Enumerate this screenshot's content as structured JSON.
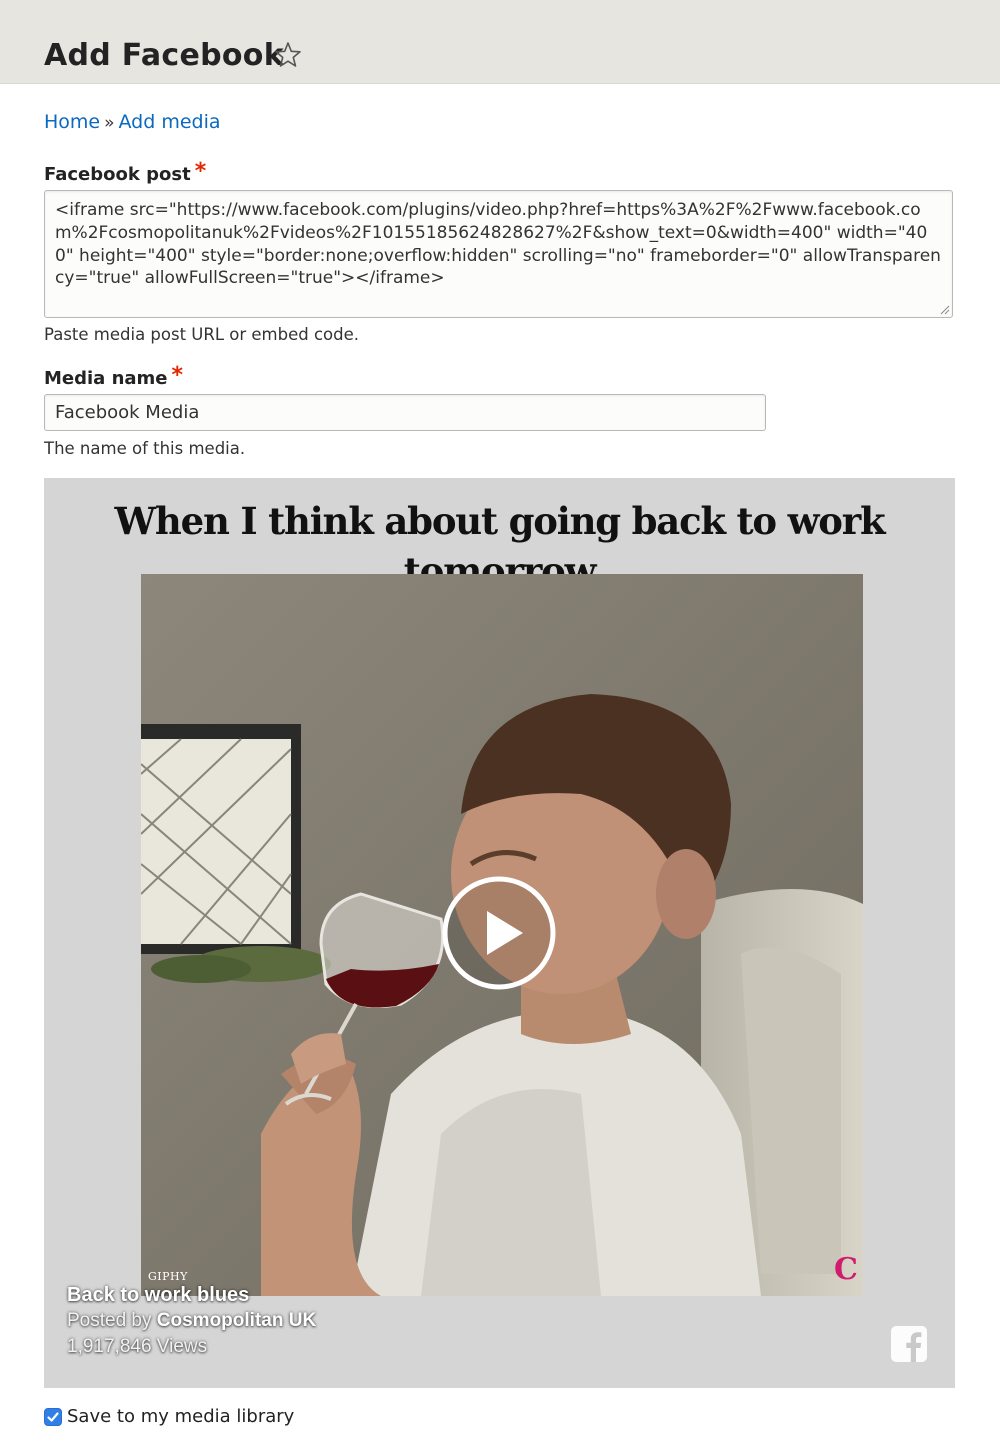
{
  "header": {
    "title": "Add Facebook",
    "favorite_icon": "star-outline-icon"
  },
  "breadcrumb": {
    "items": [
      "Home",
      "Add media"
    ],
    "separator": "»"
  },
  "facebook_post": {
    "label": "Facebook post",
    "required_marker": "*",
    "value": "<iframe src=\"https://www.facebook.com/plugins/video.php?href=https%3A%2F%2Fwww.facebook.com%2Fcosmopolitanuk%2Fvideos%2F10155185624828627%2F&show_text=0&width=400\" width=\"400\" height=\"400\" style=\"border:none;overflow:hidden\" scrolling=\"no\" frameborder=\"0\" allowTransparency=\"true\" allowFullScreen=\"true\"></iframe>",
    "description": "Paste media post URL or embed code."
  },
  "media_name": {
    "label": "Media name",
    "required_marker": "*",
    "value": "Facebook Media",
    "description": "The name of this media."
  },
  "preview": {
    "headline": "When I think about going back to work tomorrow",
    "giphy_credit": "GIPHY",
    "brand_mark": "C",
    "video_title": "Back to work blues",
    "posted_by_prefix": "Posted by",
    "posted_by_name": "Cosmopolitan UK",
    "views": "1,917,846 Views",
    "play_icon": "play-icon",
    "facebook_icon": "facebook-logo-icon",
    "background_color": "#d5d5d5"
  },
  "save_to_library": {
    "label": "Save to my media library",
    "checked": true
  },
  "colors": {
    "link": "#0b69c0",
    "required": "#e62600",
    "header_bg": "#e6e5df",
    "checkbox": "#2f7fe6"
  }
}
